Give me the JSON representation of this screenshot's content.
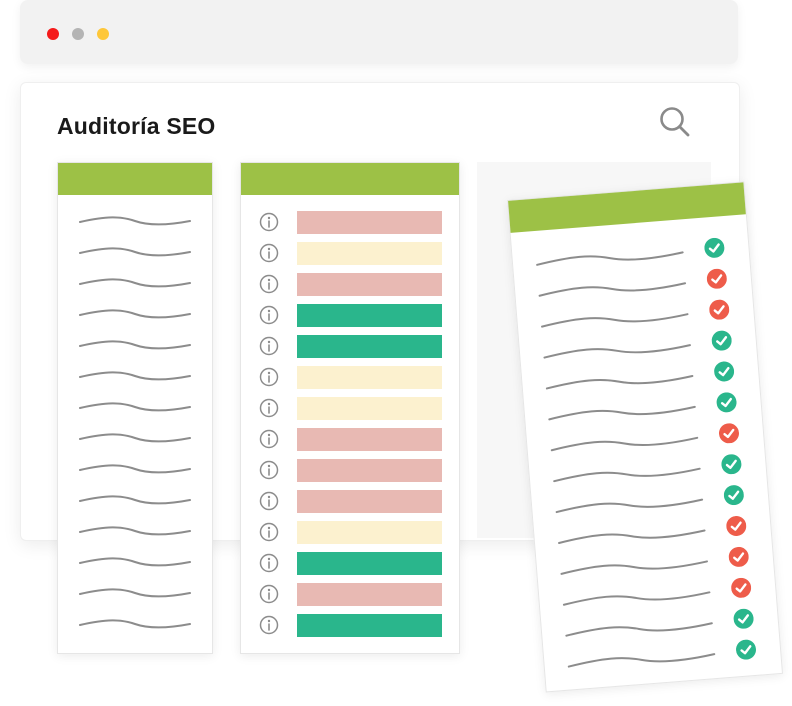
{
  "window": {
    "title": "Auditoría SEO",
    "controls": [
      {
        "name": "close-dot",
        "color": "#f51a1a"
      },
      {
        "name": "minimize-dot",
        "color": "#b4b4b4"
      },
      {
        "name": "maximize-dot",
        "color": "#fec739"
      }
    ]
  },
  "icons": {
    "search": "search-icon",
    "info": "info-icon",
    "check": "check-icon"
  },
  "colors": {
    "accent_green": "#9dc146",
    "status_red": "#e8b9b3",
    "status_yellow": "#fcf1cf",
    "status_green": "#2ab68c",
    "check_green": "#2ab68c",
    "check_red": "#ee5c4a"
  },
  "checklist_items": 14,
  "status_bars": [
    "red",
    "yellow",
    "red",
    "green",
    "green",
    "yellow",
    "yellow",
    "red",
    "red",
    "red",
    "yellow",
    "green",
    "red",
    "green"
  ],
  "checks": [
    "green",
    "red",
    "red",
    "green",
    "green",
    "green",
    "red",
    "green",
    "green",
    "red",
    "red",
    "red",
    "green",
    "green"
  ]
}
